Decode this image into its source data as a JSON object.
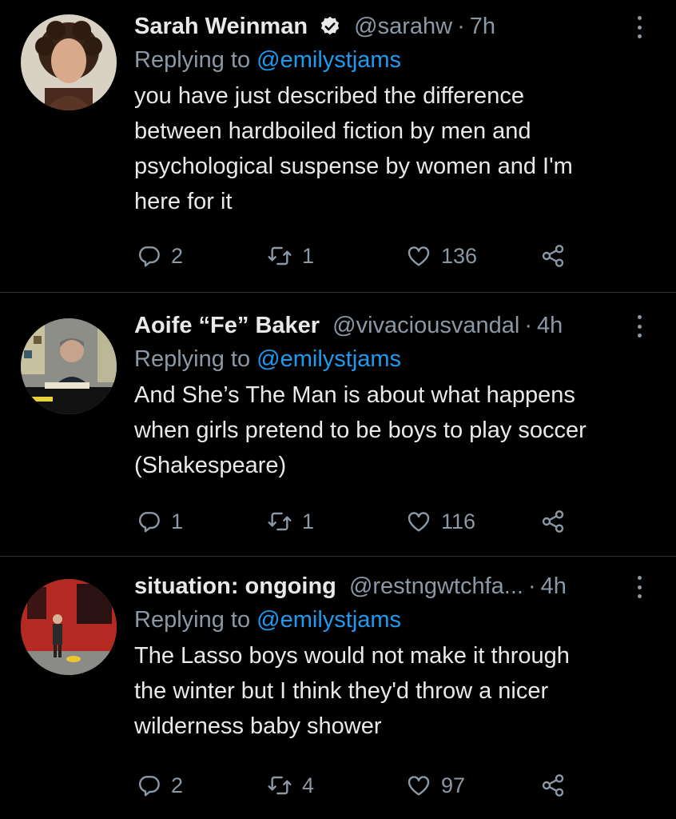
{
  "tweets": [
    {
      "name": "Sarah Weinman",
      "verified": true,
      "handle": "@sarahw",
      "time": "7h",
      "replying_prefix": "Replying to ",
      "replying_to": "@emilystjams",
      "text": "you have just described the difference between hardboiled fiction by men and psychological suspense by women and I'm here for it",
      "text_lines": [
        "you have just described the difference",
        "between hardboiled fiction by men and",
        "psychological suspense by women and I'm",
        "here for it"
      ],
      "replies": "2",
      "retweets": "1",
      "likes": "136"
    },
    {
      "name": "Aoife “Fe” Baker",
      "verified": false,
      "handle": "@vivaciousvandal",
      "time": "4h",
      "replying_prefix": "Replying to ",
      "replying_to": "@emilystjams",
      "text": "And She’s The Man is about what happens when girls pretend to be boys to play soccer (Shakespeare)",
      "text_lines": [
        "And She’s The Man is about what happens",
        "when girls pretend to be boys to play soccer",
        "(Shakespeare)"
      ],
      "replies": "1",
      "retweets": "1",
      "likes": "116"
    },
    {
      "name": "situation: ongoing",
      "verified": false,
      "handle": "@restngwtchfa...",
      "time": "4h",
      "replying_prefix": "Replying to ",
      "replying_to": "@emilystjams",
      "text": "The Lasso boys would not make it through the winter but I think they'd throw a nicer wilderness baby shower",
      "text_lines": [
        "The Lasso boys would not make it through",
        "the winter but I think they'd throw a nicer",
        "wilderness baby shower"
      ],
      "replies": "2",
      "retweets": "4",
      "likes": "97"
    }
  ],
  "separator": "·",
  "icons": {
    "reply": "reply-icon",
    "retweet": "retweet-icon",
    "like": "heart-icon",
    "share": "share-icon",
    "more": "more-icon",
    "verified": "verified-badge-icon"
  },
  "colors": {
    "background": "#000000",
    "text": "#e7e9ea",
    "secondary": "#8b98a5",
    "link": "#1d9bf0",
    "divider": "#2f3336"
  }
}
